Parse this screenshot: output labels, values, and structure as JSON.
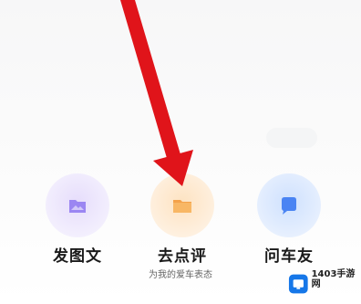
{
  "actions": [
    {
      "label": "发图文",
      "icon": "image-post-icon",
      "color": "#8b6cf0"
    },
    {
      "label": "去点评",
      "icon": "review-icon",
      "color": "#f5a63c"
    },
    {
      "label": "问车友",
      "icon": "chat-bubble-icon",
      "color": "#3f7bf2"
    }
  ],
  "review_hint": "为我的爱车表态",
  "annotation": {
    "color": "#e0141a"
  },
  "watermark": {
    "title": "1403手游网"
  }
}
